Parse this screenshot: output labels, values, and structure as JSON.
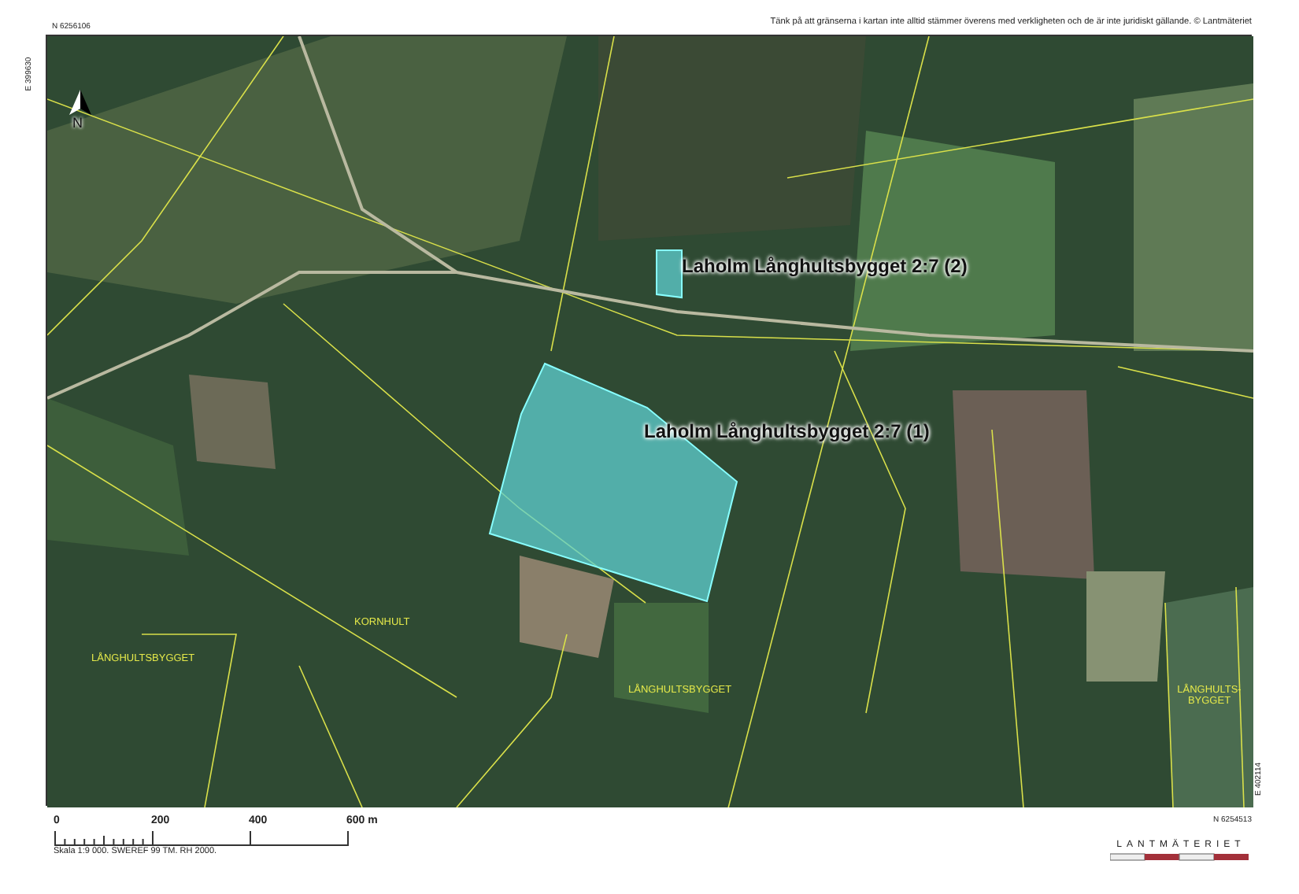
{
  "header": {
    "coordinate_north": "N 6256106",
    "notice": "Tänk på att gränserna i kartan inte alltid stämmer överens med verkligheten och de är inte juridiskt gällande. © Lantmäteriet"
  },
  "map": {
    "coordinate_west": "E 399630",
    "coordinate_east": "E 402114",
    "coordinate_south": "N 6254513",
    "north_label": "N",
    "parcels": [
      {
        "label": "Laholm Långhultsbygget 2:7 (2)",
        "kind": "small"
      },
      {
        "label": "Laholm Långhultsbygget 2:7 (1)",
        "kind": "large"
      }
    ],
    "place_names": [
      "KORNHULT",
      "LÅNGHULTSBYGGET",
      "LÅNGHULTSBYGGET",
      "LÅNGHULTS-BYGGET"
    ]
  },
  "scale_bar": {
    "ticks": [
      "0",
      "200",
      "400",
      "600 m"
    ],
    "caption": "Skala 1:9 000. SWEREF 99 TM. RH 2000."
  },
  "logo": {
    "text": "LANTMÄTERIET"
  }
}
